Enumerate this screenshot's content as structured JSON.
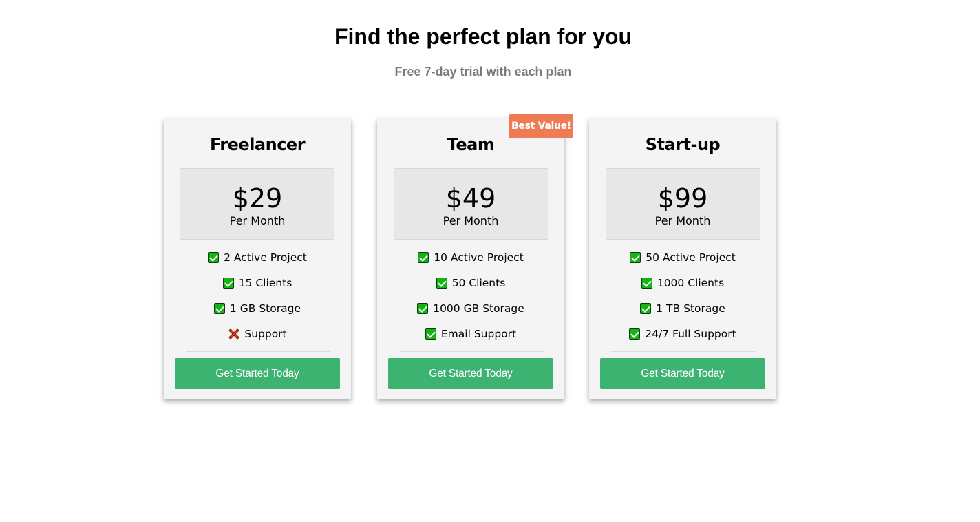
{
  "header": {
    "title": "Find the perfect plan for you",
    "subtitle": "Free 7-day trial with each plan"
  },
  "plans": [
    {
      "name": "Freelancer",
      "price": "$29",
      "period": "Per Month",
      "features": [
        {
          "label": "2 Active Project",
          "included": true,
          "icon": "check-icon"
        },
        {
          "label": "15 Clients",
          "included": true,
          "icon": "check-icon"
        },
        {
          "label": "1 GB Storage",
          "included": true,
          "icon": "check-icon"
        },
        {
          "label": "Support",
          "included": false,
          "icon": "cross-icon"
        }
      ],
      "cta": "Get Started Today"
    },
    {
      "name": "Team",
      "price": "$49",
      "period": "Per Month",
      "badge": "Best Value!",
      "features": [
        {
          "label": "10 Active Project",
          "included": true,
          "icon": "check-icon"
        },
        {
          "label": "50 Clients",
          "included": true,
          "icon": "check-icon"
        },
        {
          "label": "1000 GB Storage",
          "included": true,
          "icon": "check-icon"
        },
        {
          "label": "Email Support",
          "included": true,
          "icon": "check-icon"
        }
      ],
      "cta": "Get Started Today"
    },
    {
      "name": "Start-up",
      "price": "$99",
      "period": "Per Month",
      "features": [
        {
          "label": "50 Active Project",
          "included": true,
          "icon": "check-icon"
        },
        {
          "label": "1000 Clients",
          "included": true,
          "icon": "check-icon"
        },
        {
          "label": "1 TB Storage",
          "included": true,
          "icon": "check-icon"
        },
        {
          "label": "24/7 Full Support",
          "included": true,
          "icon": "check-icon"
        }
      ],
      "cta": "Get Started Today"
    }
  ],
  "colors": {
    "button": "#3cb371",
    "badge": "#ef7b55",
    "card": "#f4f4f4",
    "price_box": "#e7e7e7",
    "check": "#13b513",
    "cross": "#d84a1e",
    "subtitle": "#7a7a7a"
  }
}
